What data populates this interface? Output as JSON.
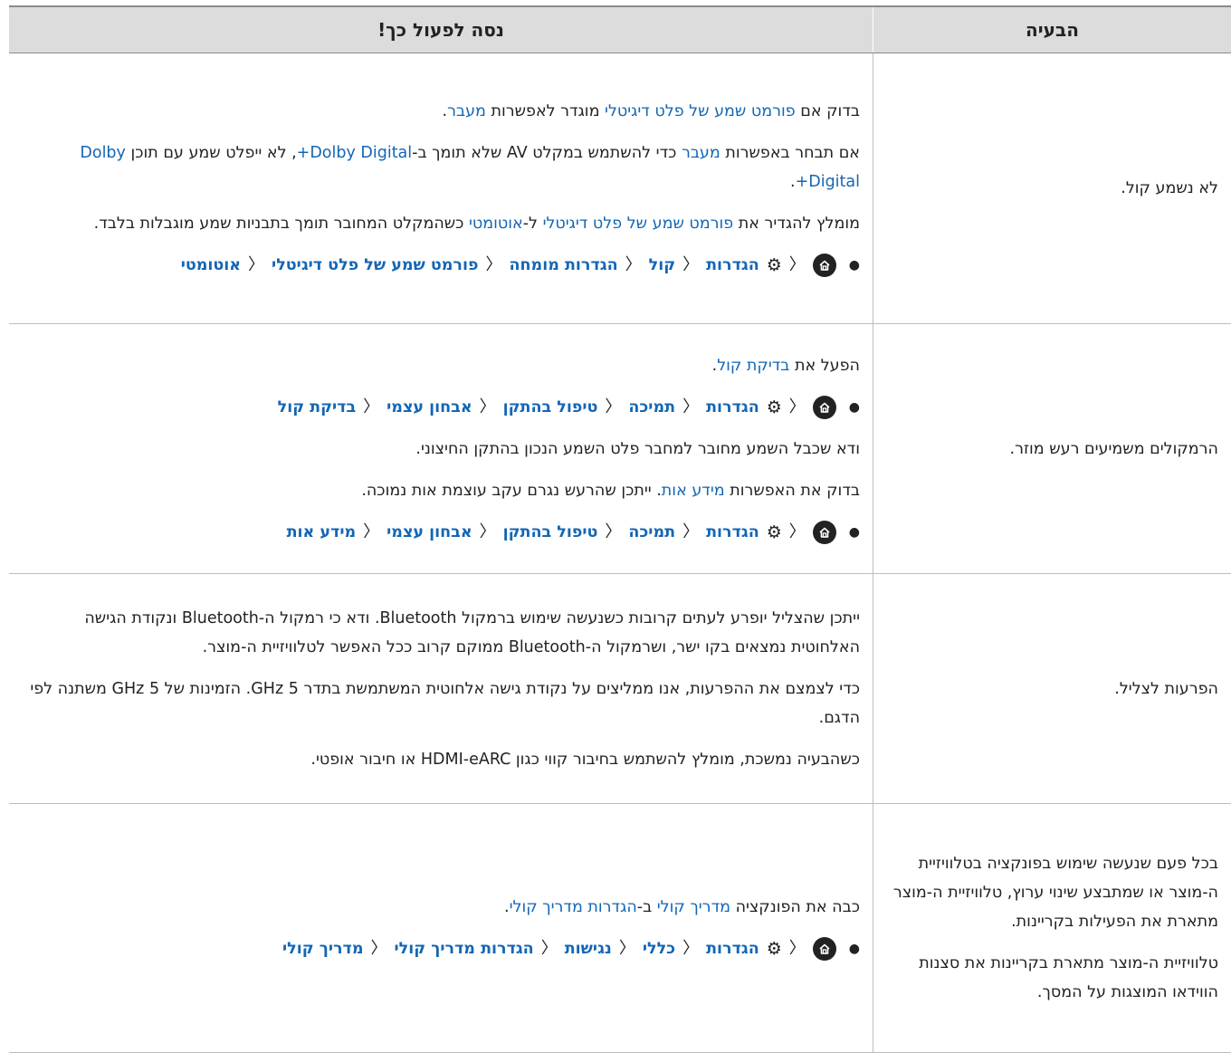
{
  "header": {
    "problem": "הבעיה",
    "solution": "נסה לפעול כך!"
  },
  "rows": [
    {
      "problem": "לא נשמע קול.",
      "lines": [
        [
          {
            "t": "בדוק אם "
          },
          {
            "t": "פורמט שמע של פלט דיגיטלי",
            "hl": true
          },
          {
            "t": " מוגדר לאפשרות "
          },
          {
            "t": "מעבר",
            "hl": true
          },
          {
            "t": "."
          }
        ],
        [
          {
            "t": "אם תבחר באפשרות "
          },
          {
            "t": "מעבר",
            "hl": true
          },
          {
            "t": " כדי להשתמש במקלט AV שלא תומך ב-"
          },
          {
            "t": "Dolby Digital+",
            "hl": true
          },
          {
            "t": ", לא ייפלט שמע עם תוכן "
          },
          {
            "t": "Dolby Digital+",
            "hl": true
          },
          {
            "t": "."
          }
        ],
        [
          {
            "t": "מומלץ להגדיר את "
          },
          {
            "t": "פורמט שמע של פלט דיגיטלי",
            "hl": true
          },
          {
            "t": " ל-"
          },
          {
            "t": "אוטומטי",
            "hl": true
          },
          {
            "t": " כשהמקלט המחובר תומך בתבניות שמע מוגבלות בלבד."
          }
        ]
      ],
      "path": [
        "הגדרות",
        "קול",
        "הגדרות מומחה",
        "פורמט שמע של פלט דיגיטלי",
        "אוטומטי"
      ]
    },
    {
      "problem": "הרמקולים משמיעים רעש מוזר.",
      "lines": [
        [
          {
            "t": "הפעל את "
          },
          {
            "t": "בדיקת קול",
            "hl": true
          },
          {
            "t": "."
          }
        ],
        "PATH:0",
        [
          {
            "t": "ודא שכבל השמע מחובר למחבר פלט השמע הנכון בהתקן החיצוני."
          }
        ],
        [
          {
            "t": "בדוק את האפשרות "
          },
          {
            "t": "מידע אות",
            "hl": true
          },
          {
            "t": ". ייתכן שהרעש נגרם עקב עוצמת אות נמוכה."
          }
        ],
        "PATH:1"
      ],
      "paths": [
        [
          "הגדרות",
          "תמיכה",
          "טיפול בהתקן",
          "אבחון עצמי",
          "בדיקת קול"
        ],
        [
          "הגדרות",
          "תמיכה",
          "טיפול בהתקן",
          "אבחון עצמי",
          "מידע אות"
        ]
      ]
    },
    {
      "problem": "הפרעות לצליל.",
      "lines": [
        [
          {
            "t": "ייתכן שהצליל יופרע לעתים קרובות כשנעשה שימוש ברמקול Bluetooth. ודא כי רמקול ה-Bluetooth ונקודת הגישה האלחוטית נמצאים בקו ישר, ושרמקול ה-Bluetooth ממוקם קרוב ככל האפשר לטלוויזיית ה-מוצר."
          }
        ],
        [
          {
            "t": "כדי לצמצם את ההפרעות, אנו ממליצים על נקודת גישה אלחוטית המשתמשת בתדר 5 GHz. הזמינות של 5 GHz משתנה לפי הדגם."
          }
        ],
        [
          {
            "t": "כשהבעיה נמשכת, מומלץ להשתמש בחיבור קווי כגון HDMI-eARC או חיבור אופטי."
          }
        ]
      ]
    },
    {
      "problem_lines": [
        "בכל פעם שנעשה שימוש בפונקציה בטלוויזיית ה-מוצר או שמתבצע שינוי ערוץ, טלוויזיית ה-מוצר מתארת את הפעילות בקריינות.",
        "טלוויזיית ה-מוצר מתארת בקריינות את סצנות הווידאו המוצגות על המסך."
      ],
      "lines": [
        [
          {
            "t": "כבה את הפונקציה "
          },
          {
            "t": "מדריך קולי",
            "hl": true
          },
          {
            "t": " ב-"
          },
          {
            "t": "הגדרות מדריך קולי",
            "hl": true
          },
          {
            "t": "."
          }
        ]
      ],
      "path": [
        "הגדרות",
        "כללי",
        "נגישות",
        "הגדרות מדריך קולי",
        "מדריך קולי"
      ]
    }
  ],
  "icons": {
    "home": "home-icon",
    "settings": "gear-icon",
    "chevron": "chevron-left-icon"
  },
  "colors": {
    "link": "#1366b5",
    "header_bg": "#dcdcdc"
  }
}
